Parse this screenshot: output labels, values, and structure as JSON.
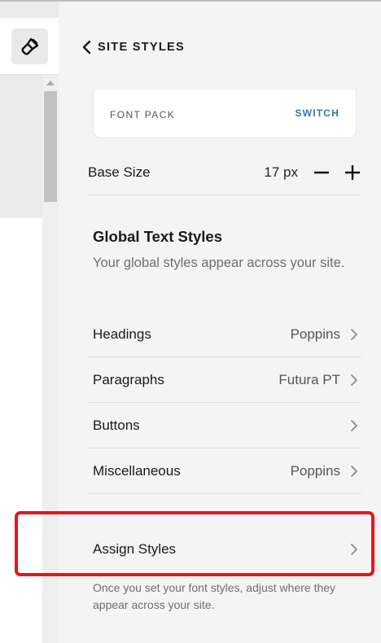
{
  "header": {
    "title": "SITE STYLES"
  },
  "font_pack": {
    "label": "FONT PACK",
    "action": "SWITCH"
  },
  "base_size": {
    "label": "Base Size",
    "value": "17 px"
  },
  "global": {
    "title": "Global Text Styles",
    "description": "Your global styles appear across your site."
  },
  "styles": [
    {
      "label": "Headings",
      "value": "Poppins"
    },
    {
      "label": "Paragraphs",
      "value": "Futura PT"
    },
    {
      "label": "Buttons",
      "value": ""
    },
    {
      "label": "Miscellaneous",
      "value": "Poppins"
    }
  ],
  "assign": {
    "label": "Assign Styles",
    "note": "Once you set your font styles, adjust where they appear across your site."
  },
  "icons": {
    "tool": "paintbrush-icon",
    "back": "chevron-left-icon",
    "row": "chevron-right-icon",
    "minus": "minus-icon",
    "plus": "plus-icon"
  },
  "colors": {
    "highlight": "#e8141c",
    "link": "#3a72a8"
  }
}
